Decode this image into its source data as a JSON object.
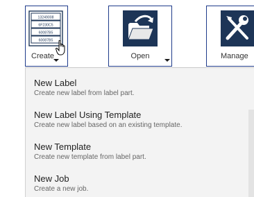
{
  "toolbar": {
    "create": {
      "label": "Create",
      "icon": "barcode-stack-icon",
      "values": [
        "13249008",
        "6F230C5",
        "60087B5",
        "60087B5"
      ]
    },
    "open": {
      "label": "Open",
      "icon": "open-folder-icon"
    },
    "manage": {
      "label": "Manage",
      "icon": "tools-icon"
    }
  },
  "menu": {
    "items": [
      {
        "title": "New Label",
        "description": "Create new label from label part."
      },
      {
        "title": "New Label Using Template",
        "description": "Create new label based on an existing template."
      },
      {
        "title": "New Template",
        "description": "Create new template from label part."
      },
      {
        "title": "New Job",
        "description": "Create a new job."
      }
    ]
  },
  "colors": {
    "accent": "#1e3a8a",
    "icon_dark": "#1d3557"
  }
}
